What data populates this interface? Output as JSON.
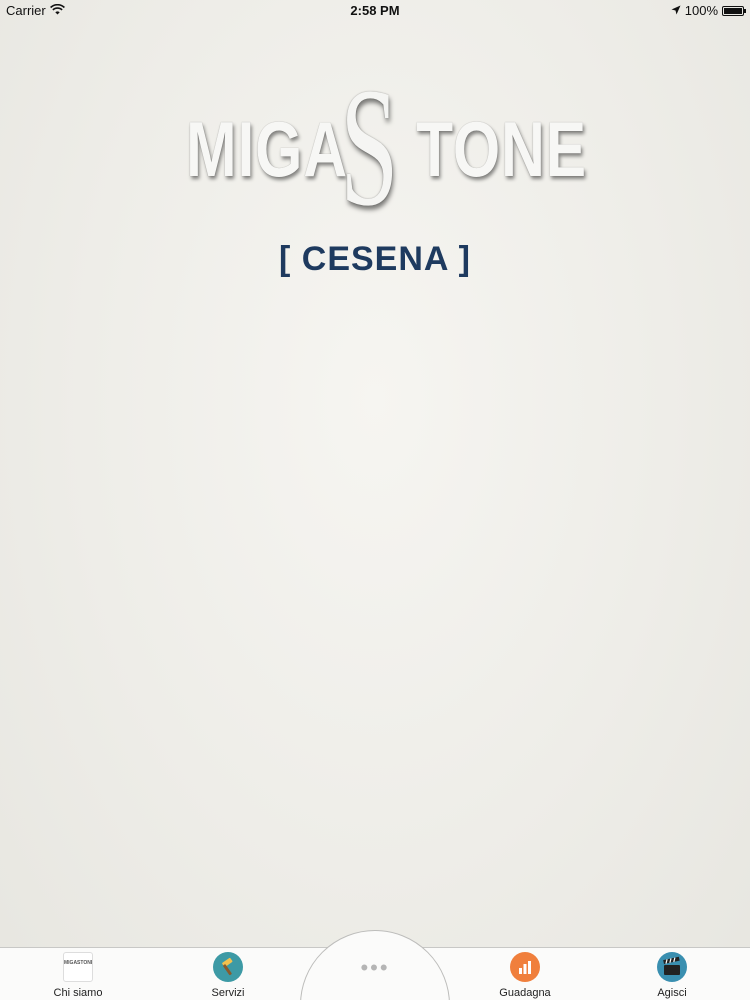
{
  "status_bar": {
    "carrier": "Carrier",
    "time": "2:58 PM",
    "battery_text": "100%",
    "wifi_icon": "wifi-icon",
    "location_icon": "location-arrow-icon",
    "battery_icon": "battery-icon"
  },
  "logo": {
    "part1": "MIGA",
    "s_letter": "S",
    "part2": "TONE"
  },
  "subtitle": "[ CESENA ]",
  "tab_bar": {
    "items": [
      {
        "label": "Chi siamo",
        "icon": "migastone-logo-icon",
        "logo_text": "MIGASTONE"
      },
      {
        "label": "Servizi",
        "icon": "hammer-icon"
      },
      {
        "label": "...",
        "icon": "more-icon"
      },
      {
        "label": "Guadagna",
        "icon": "bar-chart-icon"
      },
      {
        "label": "Agisci",
        "icon": "clapperboard-icon"
      }
    ]
  },
  "colors": {
    "subtitle": "#1e3a5f",
    "servizi_icon_bg": "#3d9aa5",
    "guadagna_icon_bg": "#f07f3c",
    "agisci_icon_bg": "#3a8fb0"
  }
}
